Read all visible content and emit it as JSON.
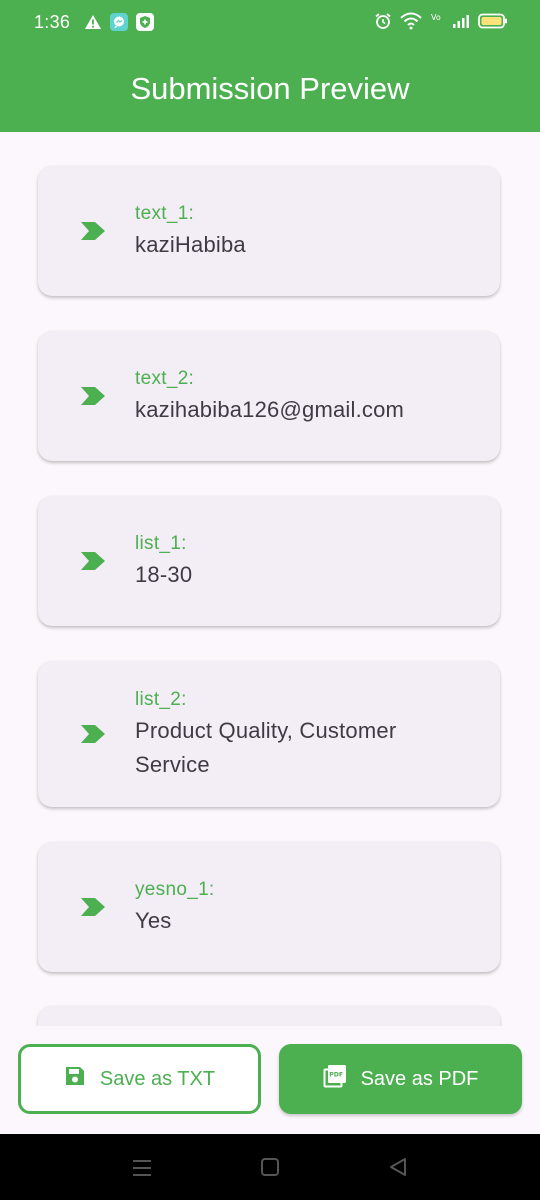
{
  "status_bar": {
    "time": "1:36",
    "left_icons": [
      "warning-icon",
      "messenger-icon",
      "shield-icon"
    ],
    "right_icons": [
      "alarm-icon",
      "wifi-icon",
      "volte-icon",
      "signal-icon",
      "battery-icon"
    ],
    "volte_label": "Vo LTE"
  },
  "app_bar": {
    "title": "Submission Preview"
  },
  "entries": [
    {
      "key": "text_1:",
      "value": "kaziHabiba"
    },
    {
      "key": "text_2:",
      "value": "kazihabiba126@gmail.com"
    },
    {
      "key": "list_1:",
      "value": "18-30"
    },
    {
      "key": "list_2:",
      "value": "Product Quality, Customer Service"
    },
    {
      "key": "yesno_1:",
      "value": "Yes"
    }
  ],
  "actions": {
    "save_txt_label": "Save as TXT",
    "save_pdf_label": "Save as PDF",
    "pdf_icon_text": "PDF"
  },
  "colors": {
    "primary": "#4caf50",
    "card_background": "#f3edf6",
    "page_background": "#fcf7fd",
    "value_text": "#3f3b45"
  }
}
